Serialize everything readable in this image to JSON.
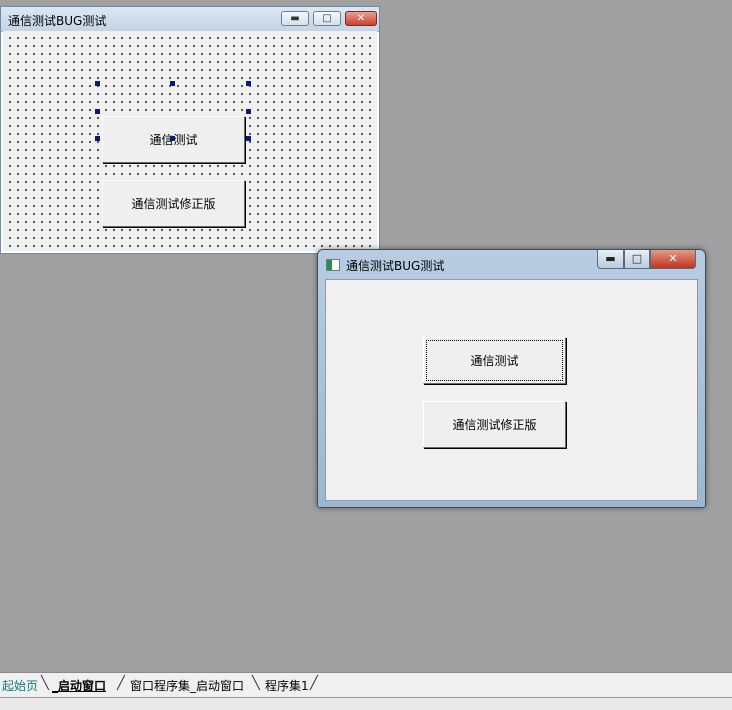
{
  "designer": {
    "title": "通信测试BUG测试",
    "buttons": {
      "test": "通信测试",
      "test_fixed": "通信测试修正版"
    },
    "controls": {
      "minimize": "▬",
      "maximize": "□",
      "close": "✕"
    }
  },
  "runtime": {
    "title": "通信测试BUG测试",
    "buttons": {
      "test": "通信测试",
      "test_fixed": "通信测试修正版"
    },
    "controls": {
      "minimize": "▬",
      "maximize": "□",
      "close": "✕"
    }
  },
  "tabs": [
    "起始页",
    "_启动窗口",
    "窗口程序集_启动窗口",
    "程序集1"
  ],
  "colors": {
    "background": "#a0a0a0",
    "start_tab": "#0f7c7c",
    "handle": "#0b1b73",
    "close": "#c8432c"
  }
}
